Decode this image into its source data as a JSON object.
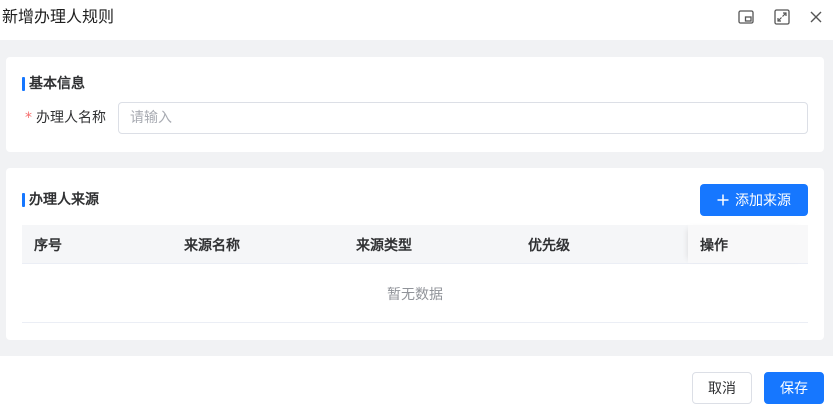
{
  "dialog": {
    "title": "新增办理人规则",
    "icons": [
      "picture-in-picture-icon",
      "fullscreen-icon",
      "close-icon"
    ]
  },
  "basic_info": {
    "section_title": "基本信息",
    "required_mark": "*",
    "name_label": "办理人名称",
    "name_placeholder": "请输入",
    "name_value": ""
  },
  "sources": {
    "section_title": "办理人来源",
    "add_button": "添加来源",
    "columns": [
      "序号",
      "来源名称",
      "来源类型",
      "优先级",
      "操作"
    ],
    "rows": [],
    "empty_text": "暂无数据"
  },
  "footer": {
    "cancel_label": "取消",
    "save_label": "保存"
  },
  "colors": {
    "primary": "#1677ff",
    "required": "#f56c6c",
    "page_bg": "#f1f2f4"
  }
}
